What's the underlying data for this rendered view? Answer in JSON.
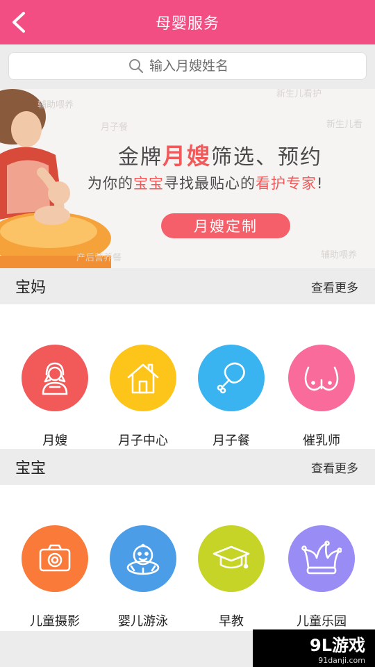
{
  "header": {
    "title": "母婴服务",
    "back_icon": "chevron-left-icon"
  },
  "search": {
    "placeholder": "输入月嫂姓名",
    "icon": "search-icon"
  },
  "banner": {
    "headline_part1": "金牌",
    "headline_highlight": "月嫂",
    "headline_part2": "筛选、预约",
    "sub_part1": "为你的",
    "sub_highlight1": "宝宝",
    "sub_part2": "寻找最贴心的",
    "sub_highlight2": "看护专家",
    "sub_part3": "!",
    "button": "月嫂定制",
    "watermarks": [
      "新生儿看护",
      "月子餐",
      "新生儿看",
      "辅助喂养",
      "产后营养餐",
      "辅助喂养"
    ]
  },
  "sections": [
    {
      "title": "宝妈",
      "more": "查看更多",
      "items": [
        {
          "label": "月嫂",
          "icon": "nanny-icon",
          "color": "#f25a5a"
        },
        {
          "label": "月子中心",
          "icon": "house-icon",
          "color": "#fdc51a"
        },
        {
          "label": "月子餐",
          "icon": "drumstick-icon",
          "color": "#3ab4f0"
        },
        {
          "label": "催乳师",
          "icon": "breast-icon",
          "color": "#f86b9b"
        }
      ]
    },
    {
      "title": "宝宝",
      "more": "查看更多",
      "items": [
        {
          "label": "儿童摄影",
          "icon": "camera-icon",
          "color": "#fa7a3a"
        },
        {
          "label": "婴儿游泳",
          "icon": "baby-swim-icon",
          "color": "#4b9de8"
        },
        {
          "label": "早教",
          "icon": "graduation-cap-icon",
          "color": "#c5d426"
        },
        {
          "label": "儿童乐园",
          "icon": "jester-hat-icon",
          "color": "#9a8cf5"
        }
      ]
    }
  ],
  "watermark": {
    "brand": "9L游戏",
    "url": "91danji.com"
  }
}
